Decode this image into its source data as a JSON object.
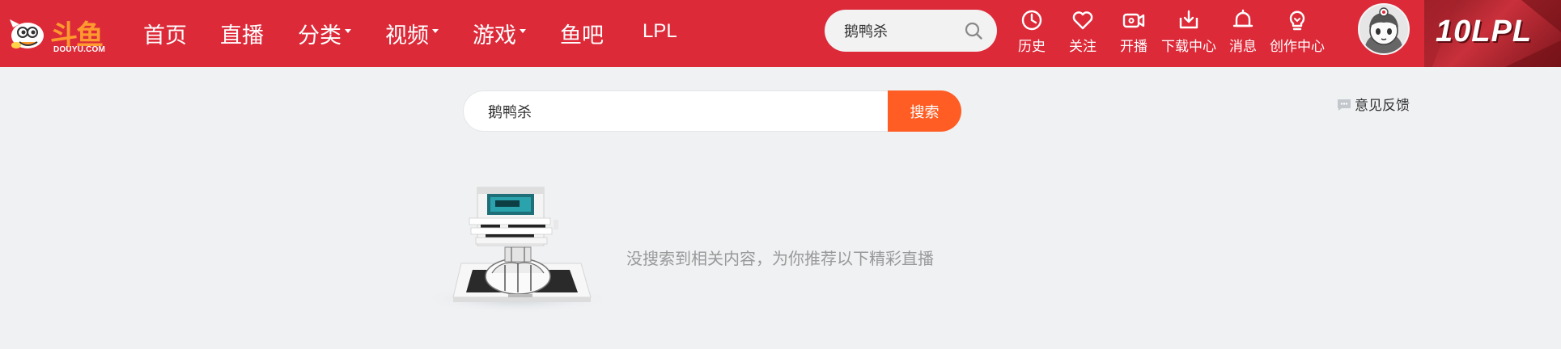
{
  "logo": {
    "cn": "斗鱼",
    "en": "DOUYU.COM"
  },
  "nav": {
    "items": [
      {
        "label": "首页",
        "has_caret": false
      },
      {
        "label": "直播",
        "has_caret": false
      },
      {
        "label": "分类",
        "has_caret": true
      },
      {
        "label": "视频",
        "has_caret": true
      },
      {
        "label": "游戏",
        "has_caret": true
      },
      {
        "label": "鱼吧",
        "has_caret": false
      },
      {
        "label": "LPL",
        "has_caret": false
      }
    ]
  },
  "top_search": {
    "value": "鹅鸭杀",
    "icon": "search-icon"
  },
  "tools": [
    {
      "label": "历史",
      "icon": "clock-icon"
    },
    {
      "label": "关注",
      "icon": "heart-icon"
    },
    {
      "label": "开播",
      "icon": "video-camera-icon"
    },
    {
      "label": "下载中心",
      "icon": "download-icon"
    },
    {
      "label": "消息",
      "icon": "bell-icon"
    },
    {
      "label": "创作中心",
      "icon": "lightbulb-icon"
    }
  ],
  "banner": {
    "text": "10LPL"
  },
  "main_search": {
    "value": "鹅鸭杀",
    "button_label": "搜索"
  },
  "feedback": {
    "label": "意见反馈",
    "icon": "message-icon"
  },
  "empty_state": {
    "message": "没搜索到相关内容，为你推荐以下精彩直播"
  },
  "colors": {
    "header_bg": "#dd2a39",
    "search_button": "#ff5d23",
    "page_bg": "#eff1f3"
  }
}
